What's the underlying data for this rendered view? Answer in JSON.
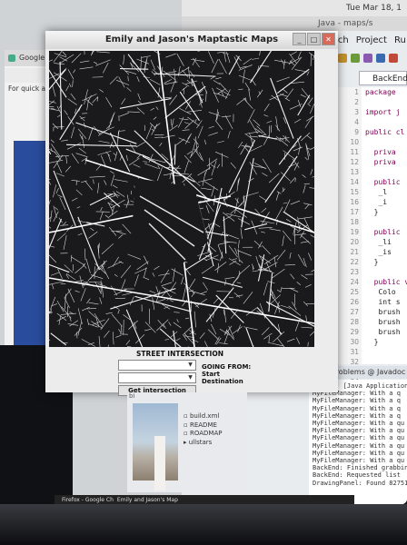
{
  "menubar": {
    "clock": "Tue Mar 18, 1"
  },
  "eclipse": {
    "title": "Java - maps/s",
    "menu": [
      "rch",
      "Project",
      "Ru"
    ],
    "tab": "BackEnd.java",
    "line_numbers": [
      "1",
      "2",
      "3",
      "4",
      "9",
      "10",
      "11",
      "12",
      "13",
      "14",
      "15",
      "16",
      "17",
      "18",
      "19",
      "20",
      "21",
      "22",
      "23",
      "24",
      "25",
      "26",
      "27",
      "28",
      "29",
      "30",
      "31",
      "32",
      "33",
      "34",
      "35",
      "36"
    ],
    "code_lines": [
      "package",
      "",
      "import j",
      "",
      "public cl",
      "",
      "  priva",
      "  priva",
      "",
      "  public",
      "   _l",
      "   _i",
      "  }",
      "",
      "  public",
      "   _li",
      "   _is",
      "  }",
      "",
      "  public vo",
      "   Colo",
      "   int s",
      "   brush",
      "   brush",
      "   brush",
      "  }",
      "",
      "",
      "}",
      "",
      "",
      ""
    ],
    "bottom_tabs": "Problems  @ Javadoc",
    "console_lines": [
      "App (6) [Java Application] /",
      "MyFileManager: With a q",
      "MyFileManager: With a q",
      "MyFileManager: With a q",
      "MyFileManager: With a q",
      "MyFileManager: With a qu",
      "MyFileManager: With a qu",
      "MyFileManager: With a qu",
      "MyFileManager: With a qu",
      "MyFileManager: With a qu",
      "MyFileManager: With a qu",
      "BackEnd: Finished grabbin",
      "BackEnd: Requested list",
      "DrawingPanel: Found 82751"
    ]
  },
  "browser": {
    "tab": "Google Maps",
    "hint": "For quick acce"
  },
  "app": {
    "title": "Emily and Jason's Maptastic Maps",
    "buttons": [
      "_",
      "□",
      "✕"
    ],
    "street_label": "STREET INTERSECTION",
    "get_button": "Get intersection",
    "going_from": "GOING FROM:",
    "start": "Start",
    "destination": "Destination"
  },
  "files": {
    "folder": "bi",
    "items": [
      "build.xml",
      "README",
      "ROADMAP",
      "ullstars"
    ]
  },
  "taskbar": {
    "items": [
      "",
      "Firefox - Google Ch",
      "Emily and Jason's Map"
    ]
  }
}
